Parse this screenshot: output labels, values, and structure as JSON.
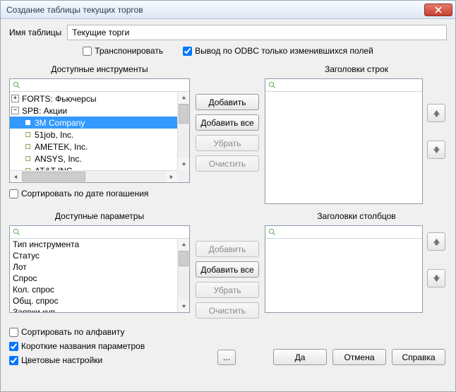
{
  "window": {
    "title": "Создание таблицы текущих торгов"
  },
  "name_label": "Имя таблицы",
  "name_value": "Текущие торги",
  "transpose_label": "Транспонировать",
  "odbc_label": "Вывод по ODBC только изменившихся  полей",
  "transpose_checked": false,
  "odbc_checked": true,
  "instruments": {
    "title": "Доступные инструменты",
    "rows_title": "Заголовки строк",
    "tree": [
      {
        "type": "branch",
        "expanded": false,
        "label": "FORTS: Фьючерсы"
      },
      {
        "type": "branch",
        "expanded": true,
        "label": "SPB: Акции",
        "children": [
          {
            "label": "3M Company",
            "selected": true
          },
          {
            "label": "51job, Inc."
          },
          {
            "label": "AMETEK, Inc."
          },
          {
            "label": "ANSYS, Inc."
          },
          {
            "label": "AT&T INC."
          }
        ]
      }
    ],
    "sort_label": "Сортировать по дате погашения",
    "sort_checked": false,
    "btn_add": "Добавить",
    "btn_add_all": "Добавить все",
    "btn_remove": "Убрать",
    "btn_clear": "Очистить"
  },
  "params": {
    "title": "Доступные параметры",
    "cols_title": "Заголовки столбцов",
    "list": [
      "Тип инструмента",
      "Статус",
      "Лот",
      "Спрос",
      "Кол. спрос",
      "Общ. спрос",
      "Заявки куп."
    ],
    "btn_add": "Добавить",
    "btn_add_all": "Добавить все",
    "btn_remove": "Убрать",
    "btn_clear": "Очистить"
  },
  "opts": {
    "sort_alpha": "Сортировать по алфавиту",
    "sort_alpha_checked": false,
    "short_names": "Короткие названия параметров",
    "short_names_checked": true,
    "colors": "Цветовые настройки",
    "colors_checked": true
  },
  "footer": {
    "ok": "Да",
    "cancel": "Отмена",
    "help": "Справка"
  }
}
